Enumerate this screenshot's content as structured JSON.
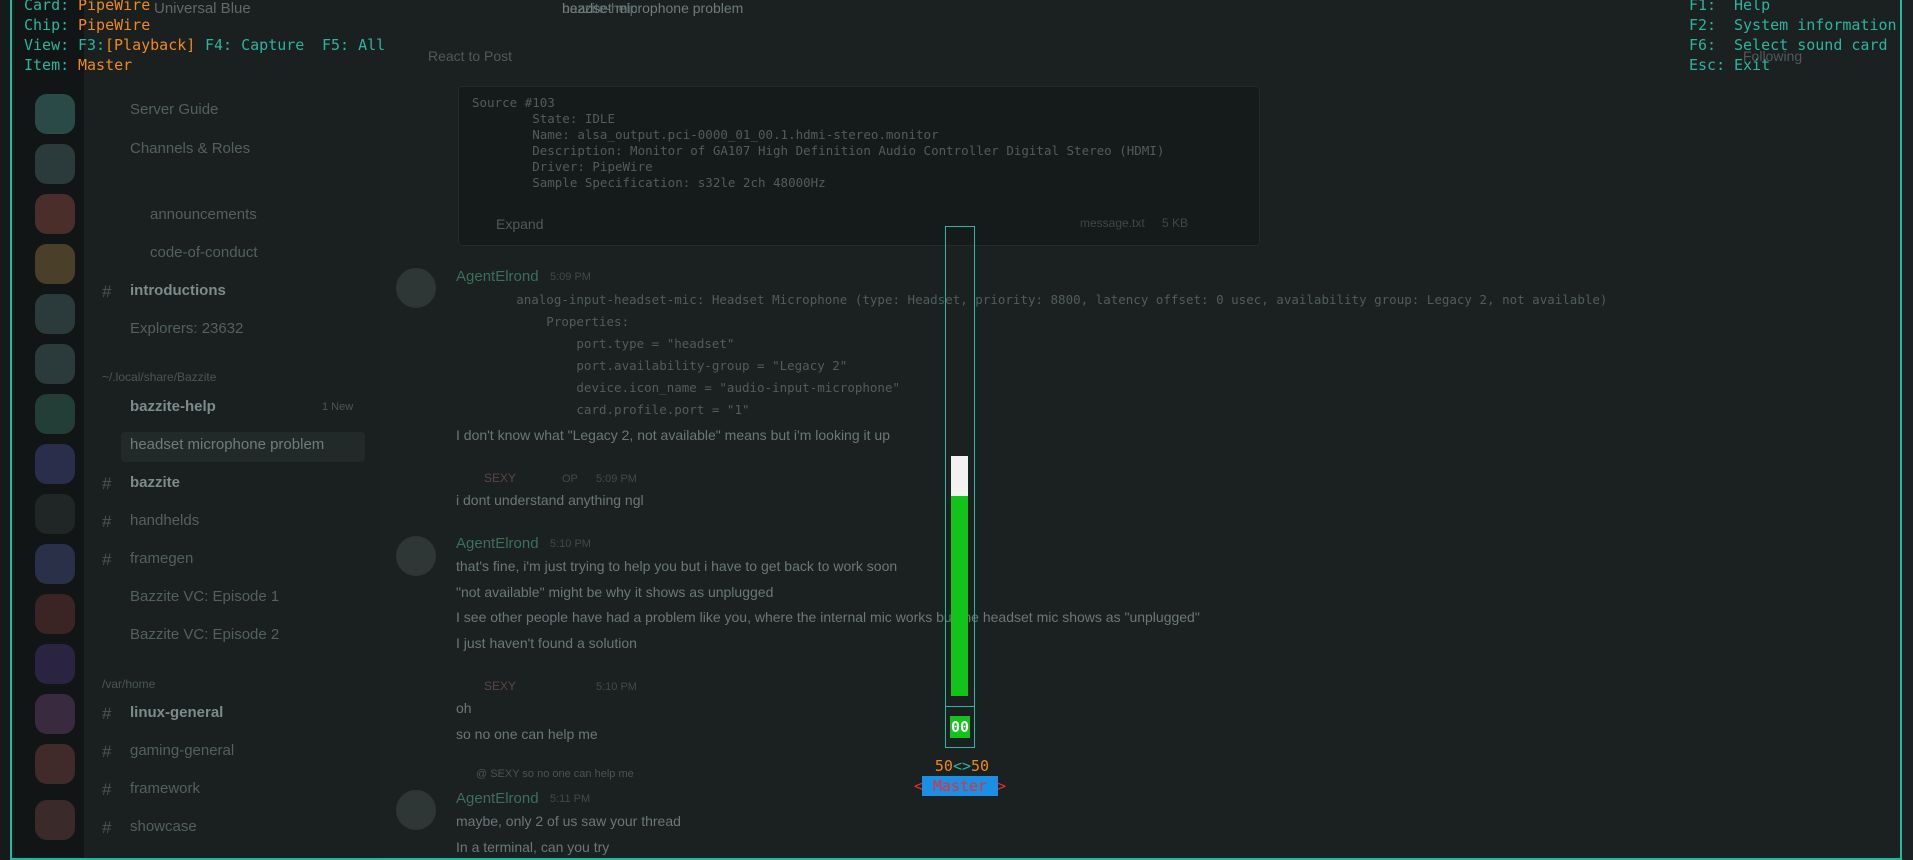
{
  "alsamixer": {
    "card_label": "Card:",
    "card_value": "PipeWire",
    "chip_label": "Chip:",
    "chip_value": "PipeWire",
    "view_label": "View:",
    "view_f3": "F3:",
    "view_playback": "[Playback]",
    "view_f4": "F4: Capture",
    "view_f5": "F5: All",
    "item_label": "Item:",
    "item_value": "Master",
    "help": [
      {
        "key": "F1:",
        "action": "Help"
      },
      {
        "key": "F2:",
        "action": "System information"
      },
      {
        "key": "F6:",
        "action": "Select sound card"
      },
      {
        "key": "Esc:",
        "action": "Exit"
      }
    ],
    "mute_indicator": "00",
    "level_left": "50",
    "level_sep": "<>",
    "level_right": "50",
    "control_name": "Master",
    "bracket_left": "<",
    "bracket_right": ">",
    "volume_fraction": 0.5,
    "colors": {
      "accent": "#2bb5a0",
      "highlight": "#f08a1e",
      "bar": "#12c41a",
      "selected_bg": "#1a8fe3",
      "selected_fg": "#e82f2f"
    }
  },
  "background": {
    "server_title": "Universal Blue",
    "channel_title": "bazzite-help",
    "thread_title": "headset microphone problem",
    "react_label": "React to Post",
    "following_label": "Following",
    "channels": [
      {
        "label": "Server Guide",
        "icon": "guide-icon"
      },
      {
        "label": "Channels & Roles",
        "icon": "list-icon"
      },
      {
        "label": "announcements",
        "icon": "megaphone-icon"
      },
      {
        "label": "code-of-conduct",
        "icon": "check-icon"
      },
      {
        "label": "introductions",
        "icon": "hash-icon"
      },
      {
        "label": "Explorers: 23632",
        "icon": "lock-icon"
      },
      {
        "label": "~/.local/share/Bazzite",
        "icon": "category"
      },
      {
        "label": "bazzite-help",
        "icon": "forum-icon",
        "badge": "1 New"
      },
      {
        "label": "headset microphone problem",
        "icon": "thread"
      },
      {
        "label": "bazzite",
        "icon": "hash-icon"
      },
      {
        "label": "handhelds",
        "icon": "hash-icon"
      },
      {
        "label": "framegen",
        "icon": "hash-icon"
      },
      {
        "label": "Bazzite VC: Episode 1",
        "icon": "speaker-icon"
      },
      {
        "label": "Bazzite VC: Episode 2",
        "icon": "speaker-icon"
      },
      {
        "label": "/var/home",
        "icon": "category"
      },
      {
        "label": "linux-general",
        "icon": "hash-icon"
      },
      {
        "label": "gaming-general",
        "icon": "hash-icon"
      },
      {
        "label": "framework",
        "icon": "hash-icon"
      },
      {
        "label": "showcase",
        "icon": "hash-icon"
      }
    ],
    "code_source": [
      "Source #103",
      "        State: IDLE",
      "        Name: alsa_output.pci-0000_01_00.1.hdmi-stereo.monitor",
      "        Description: Monitor of GA107 High Definition Audio Controller Digital Stereo (HDMI)",
      "        Driver: PipeWire",
      "        Sample Specification: s32le 2ch 48000Hz"
    ],
    "expand_label": "Expand",
    "file_label": "message.txt",
    "file_size": "5 KB",
    "msg1_author": "AgentElrond",
    "msg1_time": "5:09 PM",
    "code_mic": [
      "        analog-input-headset-mic: Headset Microphone (type: Headset, priority: 8800, latency offset: 0 usec, availability group: Legacy 2, not available)",
      "            Properties:",
      "                port.type = \"headset\"",
      "                port.availability-group = \"Legacy 2\"",
      "                device.icon_name = \"audio-input-microphone\"",
      "                card.profile.port = \"1\""
    ],
    "msg1_text": "I don't know what \"Legacy 2, not available\" means but i'm looking it up",
    "msg2_author": "SEXY",
    "msg2_time": "5:09 PM",
    "msg2_tag": "OP",
    "msg2_text": "i dont understand anything ngl",
    "msg3_author": "AgentElrond",
    "msg3_time": "5:10 PM",
    "msg3_lines": [
      "that's fine, i'm just trying to help you but i have to get back to work soon",
      "\"not available\" might be why it shows as unplugged",
      "I see other people have had a problem like you, where the internal mic works but the headset mic shows as \"unplugged\"",
      "I just haven't found a solution"
    ],
    "msg4_author": "SEXY",
    "msg4_time": "5:10 PM",
    "msg4_lines": [
      "oh",
      "so no one can help me"
    ],
    "reply_ref": "@ SEXY so no one can help me",
    "msg5_author": "AgentElrond",
    "msg5_time": "5:11 PM",
    "msg5_lines": [
      "maybe, only 2 of us saw your thread",
      "In a terminal, can you try"
    ]
  }
}
